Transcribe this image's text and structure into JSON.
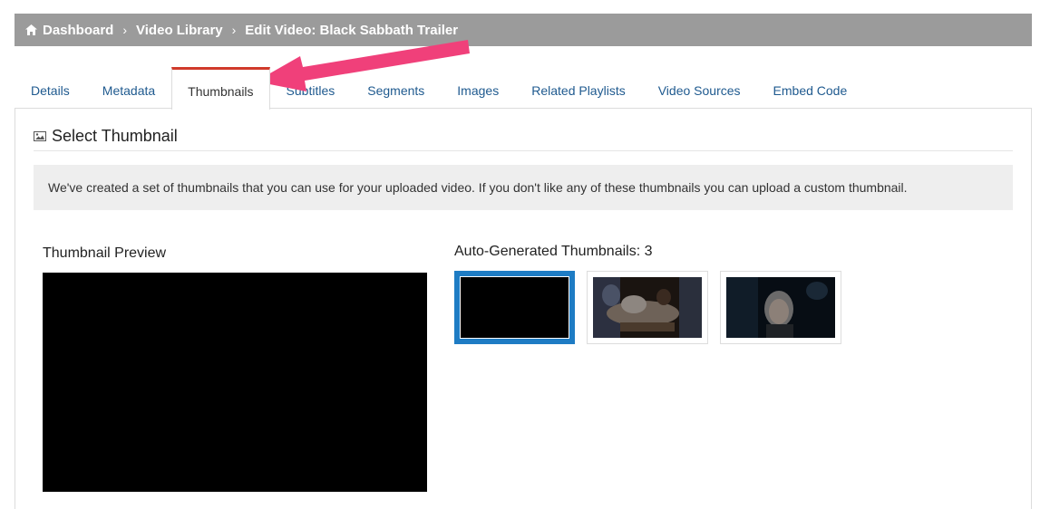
{
  "breadcrumb": {
    "home_icon": "home-icon",
    "items": [
      {
        "label": "Dashboard"
      },
      {
        "label": "Video Library"
      },
      {
        "label": "Edit Video: Black Sabbath Trailer"
      }
    ],
    "separator": "›"
  },
  "tabs": [
    {
      "label": "Details"
    },
    {
      "label": "Metadata"
    },
    {
      "label": "Thumbnails",
      "active": true
    },
    {
      "label": "Subtitles"
    },
    {
      "label": "Segments"
    },
    {
      "label": "Images"
    },
    {
      "label": "Related Playlists"
    },
    {
      "label": "Video Sources"
    },
    {
      "label": "Embed Code"
    }
  ],
  "section": {
    "icon": "image-icon",
    "title": "Select Thumbnail"
  },
  "info": {
    "message": "We've created a set of thumbnails that you can use for your uploaded video. If you don't like any of these thumbnails you can upload a custom thumbnail."
  },
  "preview": {
    "label": "Thumbnail Preview"
  },
  "auto_thumbnails": {
    "label": "Auto-Generated Thumbnails: 3",
    "items": [
      {
        "name": "thumbnail-1",
        "selected": true
      },
      {
        "name": "thumbnail-2",
        "selected": false
      },
      {
        "name": "thumbnail-3",
        "selected": false
      }
    ]
  },
  "colors": {
    "breadcrumb_bg": "#9b9b9b",
    "tab_link": "#1f5a8f",
    "active_tab_top": "#d03a2b",
    "selected_thumb_border": "#1e7cc4",
    "annotation_arrow": "#f0407a"
  }
}
